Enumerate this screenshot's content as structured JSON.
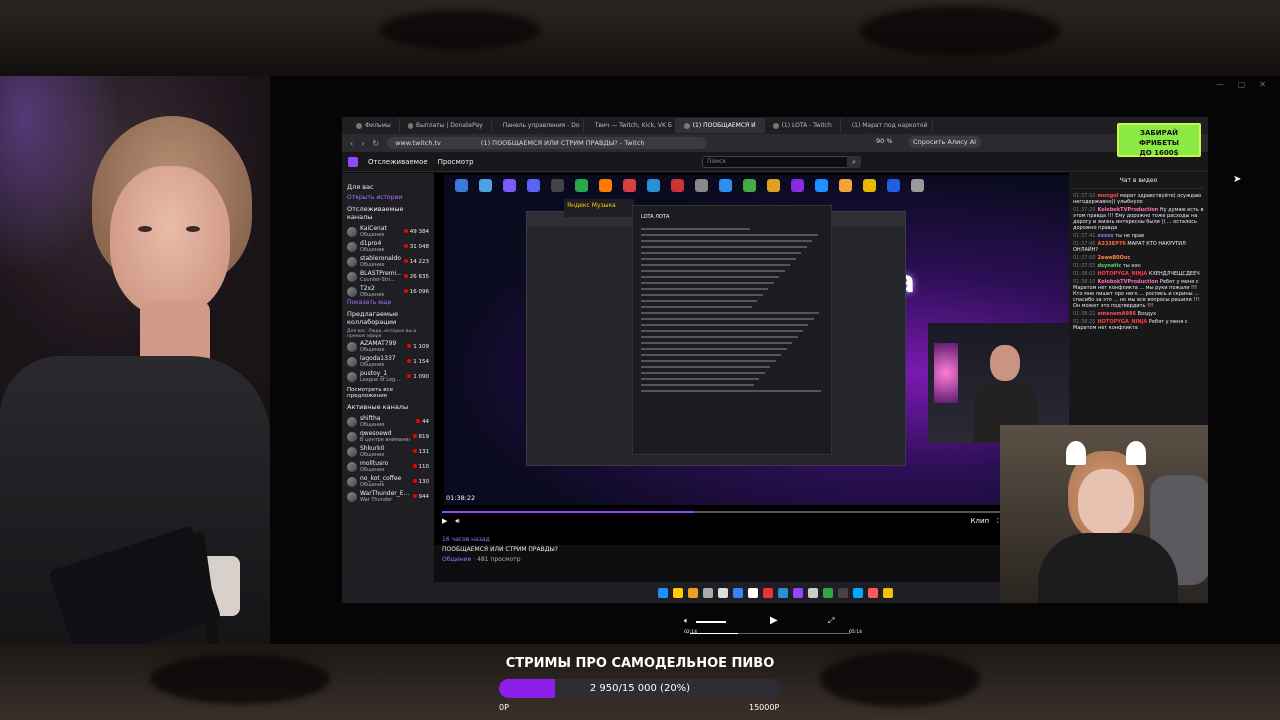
{
  "colors": {
    "goal_fill": "#8d1ee8",
    "twitch_purple": "#9147ff",
    "promo_green": "#8ce843"
  },
  "browser": {
    "tabs": [
      {
        "label": "Фильмы",
        "active": false
      },
      {
        "label": "Выплаты | DonatePay",
        "active": false
      },
      {
        "label": "Панель управления - Do",
        "active": false
      },
      {
        "label": "Твич — Twitch, Kick, VK Б",
        "active": false
      },
      {
        "label": "(1) ПООБЩАЕМСЯ И",
        "active": true
      },
      {
        "label": "(1) LOTA - Twitch",
        "active": false
      },
      {
        "label": "(1) Марат под наркотой",
        "active": false
      }
    ],
    "url": "www.twitch.tv",
    "page_title": "(1) ПООБЩАЕМСЯ ИЛИ СТРИМ ПРАВДЫ? - Twitch",
    "zoom": "90 %",
    "ask_ai": "Спросить Алису AI"
  },
  "promo": {
    "line1": "ЗАБИРАЙ",
    "line2": "ФРИБЕТЫ",
    "line3": "ДО 1600$"
  },
  "twitch": {
    "nav": [
      "Отслеживаемое",
      "Просмотр"
    ],
    "search_placeholder": "Поиск",
    "sidebar": {
      "for_you": "Для вас",
      "open_history": "Открыть истории",
      "followed_header": "Отслеживаемые каналы",
      "followed": [
        {
          "name": "KaiCenat",
          "sub": "Общение",
          "count": "49 384"
        },
        {
          "name": "d1pro4",
          "sub": "Общение",
          "count": "31 048"
        },
        {
          "name": "stableronaldo",
          "sub": "Общение",
          "count": "14 223"
        },
        {
          "name": "BLASTPremi...",
          "sub": "Counter-Stri...",
          "count": "26 635"
        },
        {
          "name": "T2x2",
          "sub": "Общение",
          "count": "16 096"
        }
      ],
      "show_more": "Показать еще",
      "suggested_header": "Предлагаемые коллаборации",
      "suggested_note": "Для вас. Люди, которые вы в прямом эфире",
      "suggested": [
        {
          "name": "AZAMAT799",
          "sub": "Общение",
          "count": "1 109"
        },
        {
          "name": "lagoda1337",
          "sub": "Общение",
          "count": "1 154"
        },
        {
          "name": "pustoy_1",
          "sub": "League of Leg...",
          "count": "1 090"
        }
      ],
      "view_all_suggestions": "Посмотреть все предложения",
      "active_header": "Активные каналы",
      "active": [
        {
          "name": "shiftha",
          "sub": "Общение",
          "count": "44"
        },
        {
          "name": "qwesoewd",
          "sub": "В центре внимания",
          "count": "819"
        },
        {
          "name": "Shkurk0",
          "sub": "Общение",
          "count": "131"
        },
        {
          "name": "molltusro",
          "sub": "Общение",
          "count": "110"
        },
        {
          "name": "no_kot_coffee",
          "sub": "Общение",
          "count": "130"
        },
        {
          "name": "WarThunder_E...",
          "sub": "War Thunder",
          "count": "944"
        }
      ]
    },
    "player": {
      "timestamp": "01:38:22",
      "doc_title": "LOTA ЛОТА",
      "music_app": "Яндекс Музыка",
      "neon_text": "на",
      "clip": "Клип"
    },
    "video_meta": {
      "ago": "16 часов назад",
      "title": "ПООБЩАЕМСЯ ИЛИ СТРИМ ПРАВДЫ?",
      "category": "Общение",
      "views": "481 просмотр"
    },
    "chat": {
      "header": "Чат в видео",
      "messages": [
        {
          "time": "01:37:10",
          "user": "mongol",
          "color": "#ff4f4f",
          "text": "марат здравствуйте) осуждаю негодержавно)) улыбнуло"
        },
        {
          "time": "01:37:20",
          "user": "KolobokTVProduction",
          "color": "#ff6fb0",
          "text": "Ну думаю есть в этом правда !!! Ему дорожно тоже расходы на дорогу и жизнь интересны были )) ... осталось дорожно правда"
        },
        {
          "time": "01:37:41",
          "user": "xxxxx",
          "color": "#7d8aff",
          "text": "ты не прав"
        },
        {
          "time": "01:37:45",
          "user": "A333EP76",
          "color": "#ff6a3d",
          "text": "МАРАТ КТО НАКРУТИЛ ОНЛАЙН?"
        },
        {
          "time": "01:37:50",
          "user": "2eweB0Ooc",
          "color": "#ff8a3d",
          "text": ""
        },
        {
          "time": "01:37:55",
          "user": "dsynatic",
          "color": "#62d27a",
          "text": "ты кон"
        },
        {
          "time": "01:38:02",
          "user": "HOTOPYGA_NINJA",
          "color": "#ff3b3b",
          "text": "КХЕНДЛЧЕЩСДЕЕЧ"
        },
        {
          "time": "01:38:10",
          "user": "KolobokTVProduction",
          "color": "#ff6fb0",
          "text": "Ребят у меня с Маратом нет конфликта ... мы руки пожали !!! Кто мне пишет про него ... роспись и скрины ... спасибо за это ... но мы все вопросы решили !!! Он может это подтвердить !!!"
        },
        {
          "time": "01:38:21",
          "user": "emenemA986",
          "color": "#ff4f4f",
          "text": "Воздух"
        },
        {
          "time": "01:38:25",
          "user": "HOTOPYGA_NINJA",
          "color": "#ff3b3b",
          "text": "Ребят у меня с Маратом нет конфликта"
        }
      ]
    }
  },
  "overlay_player": {
    "elapsed": "02:14",
    "total": "05:14",
    "progress": 0.3
  },
  "goal": {
    "title": "СТРИМЫ ПРО САМОДЕЛЬНОЕ ПИВО",
    "progress_text": "2 950/15 000 (20%)",
    "fraction": 0.2,
    "min_label": "0Р",
    "max_label": "15000Р"
  }
}
